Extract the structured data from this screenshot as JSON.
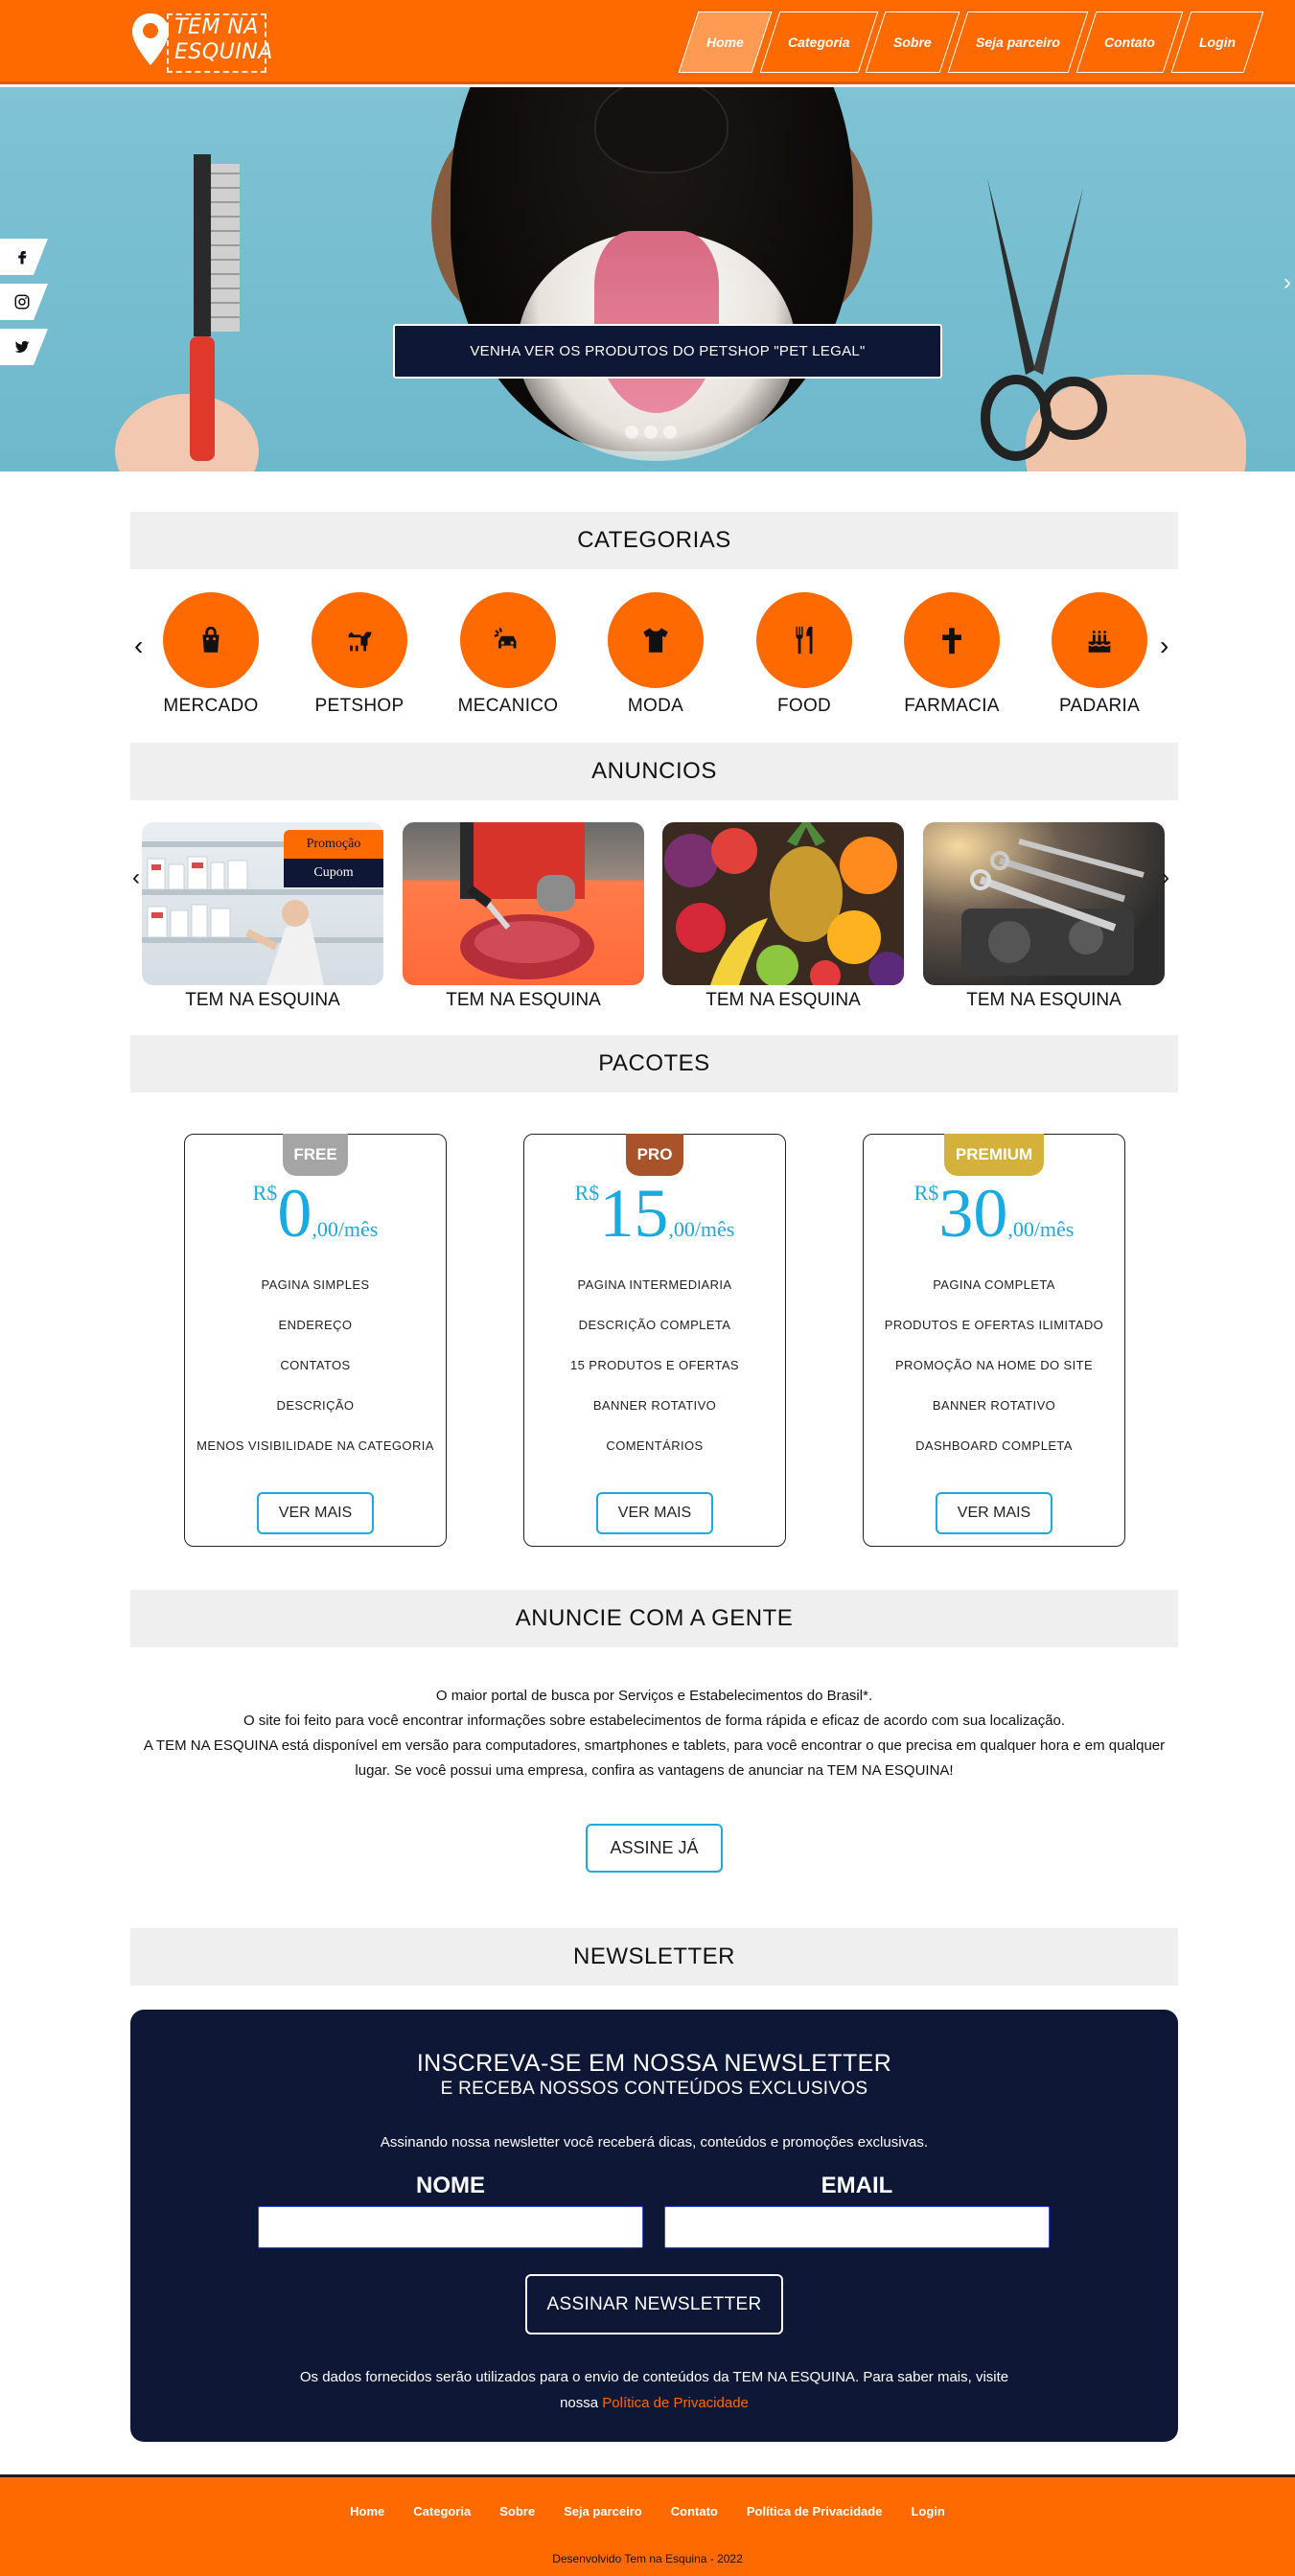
{
  "header": {
    "logo_line1": "TEM NA",
    "logo_line2": "ESQUINA",
    "nav": [
      "Home",
      "Categoria",
      "Sobre",
      "Seja parceiro",
      "Contato",
      "Login"
    ]
  },
  "hero": {
    "cta": "VENHA VER OS PRODUTOS DO PETSHOP \"PET LEGAL\"",
    "next": "›"
  },
  "social_icons": [
    "facebook-icon",
    "instagram-icon",
    "twitter-icon"
  ],
  "categories": {
    "title": "CATEGORIAS",
    "prev": "‹",
    "next": "›",
    "items": [
      {
        "label": "MERCADO",
        "icon": "shopping-bag-icon"
      },
      {
        "label": "PETSHOP",
        "icon": "dog-icon"
      },
      {
        "label": "MECANICO",
        "icon": "car-crash-icon"
      },
      {
        "label": "MODA",
        "icon": "tshirt-icon"
      },
      {
        "label": "FOOD",
        "icon": "utensils-icon"
      },
      {
        "label": "FARMACIA",
        "icon": "cross-icon"
      },
      {
        "label": "PADARIA",
        "icon": "cake-icon"
      }
    ]
  },
  "ads": {
    "title": "ANUNCIOS",
    "prev": "‹",
    "next": "›",
    "badge_promo": "Promoção",
    "badge_coupon": "Cupom",
    "items": [
      {
        "label": "TEM NA ESQUINA",
        "image": "pharmacy-image"
      },
      {
        "label": "TEM NA ESQUINA",
        "image": "butcher-image"
      },
      {
        "label": "TEM NA ESQUINA",
        "image": "fruits-image"
      },
      {
        "label": "TEM NA ESQUINA",
        "image": "mechanic-tools-image"
      }
    ]
  },
  "packages": {
    "title": "PACOTES",
    "currency": "R$",
    "plans": [
      {
        "tag": "FREE",
        "tag_color": "#a5a5a5",
        "price": "0",
        "suffix": ",00/mês",
        "features": [
          "PAGINA SIMPLES",
          "ENDEREÇO",
          "CONTATOS",
          "DESCRIÇÃO",
          "MENOS VISIBILIDADE NA CATEGORIA"
        ],
        "button": "VER MAIS"
      },
      {
        "tag": "PRO",
        "tag_color": "#a9532b",
        "price": "15",
        "suffix": ",00/mês",
        "features": [
          "PAGINA INTERMEDIARIA",
          "DESCRIÇÃO COMPLETA",
          "15 PRODUTOS E OFERTAS",
          "BANNER ROTATIVO",
          "COMENTÁRIOS"
        ],
        "button": "VER MAIS"
      },
      {
        "tag": "PREMIUM",
        "tag_color": "#d4b13b",
        "price": "30",
        "suffix": ",00/mês",
        "features": [
          "PAGINA COMPLETA",
          "PRODUTOS E OFERTAS ILIMITADO",
          "PROMOÇÃO NA HOME DO SITE",
          "BANNER ROTATIVO",
          "DASHBOARD COMPLETA"
        ],
        "button": "VER MAIS"
      }
    ]
  },
  "anuncie": {
    "title": "ANUNCIE COM A GENTE",
    "lines": [
      "O maior portal de busca por Serviços e Estabelecimentos do Brasil*.",
      "O site foi feito para você encontrar informações sobre estabelecimentos de forma rápida e eficaz de acordo com sua localização.",
      "A TEM NA ESQUINA está disponível em versão para computadores, smartphones e tablets, para você encontrar o que precisa em qualquer hora e em qualquer lugar. Se você possui uma empresa, confira as vantagens de anunciar na TEM NA ESQUINA!"
    ],
    "button": "ASSINE JÁ"
  },
  "newsletter": {
    "title": "NEWSLETTER",
    "heading1": "INSCREVA-SE EM NOSSA NEWSLETTER",
    "heading2": "E RECEBA NOSSOS CONTEÚDOS EXCLUSIVOS",
    "intro": "Assinando nossa newsletter você receberá dicas, conteúdos e promoções exclusivas.",
    "name_label": "NOME",
    "email_label": "EMAIL",
    "name_value": "",
    "email_value": "",
    "button": "ASSINAR NEWSLETTER",
    "note": "Os dados fornecidos serão utilizados para o envio de conteúdos da TEM NA ESQUINA. Para saber mais, visite nossa",
    "note_link": "Política de Privacidade",
    "accent": "#ff6a00"
  },
  "footer": {
    "nav": [
      "Home",
      "Categoria",
      "Sobre",
      "Seja parceiro",
      "Contato",
      "Política de Privacidade",
      "Login"
    ],
    "copyright": "Desenvolvido Tem na Esquina - 2022"
  },
  "colors": {
    "brand": "#ff6a00",
    "navy": "#0f1736",
    "accent_blue": "#1aa9e0"
  }
}
